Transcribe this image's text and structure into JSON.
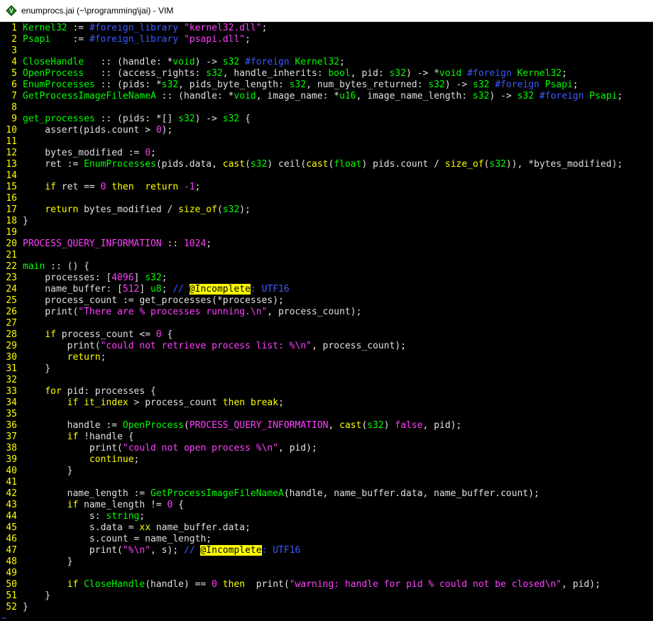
{
  "window": {
    "title": "enumprocs.jai (~\\programming\\jai) - VIM",
    "icon": "vim-icon"
  },
  "editor": {
    "lines": [
      [
        [
          "Kernel32",
          "fn"
        ],
        [
          " := ",
          "plain"
        ],
        [
          "#foreign_library",
          "dir"
        ],
        [
          " ",
          "plain"
        ],
        [
          "\"kernel32.dll\"",
          "str"
        ],
        [
          ";",
          "plain"
        ]
      ],
      [
        [
          "Psapi",
          "fn"
        ],
        [
          "    := ",
          "plain"
        ],
        [
          "#foreign_library",
          "dir"
        ],
        [
          " ",
          "plain"
        ],
        [
          "\"psapi.dll\"",
          "str"
        ],
        [
          ";",
          "plain"
        ]
      ],
      [],
      [
        [
          "CloseHandle",
          "fn"
        ],
        [
          "   :: (handle: *",
          "plain"
        ],
        [
          "void",
          "type"
        ],
        [
          ") -> ",
          "plain"
        ],
        [
          "s32",
          "type"
        ],
        [
          " ",
          "plain"
        ],
        [
          "#foreign",
          "dir"
        ],
        [
          " ",
          "plain"
        ],
        [
          "Kernel32",
          "fn"
        ],
        [
          ";",
          "plain"
        ]
      ],
      [
        [
          "OpenProcess",
          "fn"
        ],
        [
          "   :: (access_rights: ",
          "plain"
        ],
        [
          "s32",
          "type"
        ],
        [
          ", handle_inherits: ",
          "plain"
        ],
        [
          "bool",
          "type"
        ],
        [
          ", pid: ",
          "plain"
        ],
        [
          "s32",
          "type"
        ],
        [
          ") -> *",
          "plain"
        ],
        [
          "void",
          "type"
        ],
        [
          " ",
          "plain"
        ],
        [
          "#foreign",
          "dir"
        ],
        [
          " ",
          "plain"
        ],
        [
          "Kernel32",
          "fn"
        ],
        [
          ";",
          "plain"
        ]
      ],
      [
        [
          "EnumProcesses",
          "fn"
        ],
        [
          " :: (pids: *",
          "plain"
        ],
        [
          "s32",
          "type"
        ],
        [
          ", pids_byte_length: ",
          "plain"
        ],
        [
          "s32",
          "type"
        ],
        [
          ", num_bytes_returned: ",
          "plain"
        ],
        [
          "s32",
          "type"
        ],
        [
          ") -> ",
          "plain"
        ],
        [
          "s32",
          "type"
        ],
        [
          " ",
          "plain"
        ],
        [
          "#foreign",
          "dir"
        ],
        [
          " ",
          "plain"
        ],
        [
          "Psapi",
          "fn"
        ],
        [
          ";",
          "plain"
        ]
      ],
      [
        [
          "GetProcessImageFileNameA",
          "fn"
        ],
        [
          " :: (handle: *",
          "plain"
        ],
        [
          "void",
          "type"
        ],
        [
          ", image_name: *",
          "plain"
        ],
        [
          "u16",
          "type"
        ],
        [
          ", image_name_length: ",
          "plain"
        ],
        [
          "s32",
          "type"
        ],
        [
          ") -> ",
          "plain"
        ],
        [
          "s32",
          "type"
        ],
        [
          " ",
          "plain"
        ],
        [
          "#foreign",
          "dir"
        ],
        [
          " ",
          "plain"
        ],
        [
          "Psapi",
          "fn"
        ],
        [
          ";",
          "plain"
        ]
      ],
      [],
      [
        [
          "get_processes",
          "fn"
        ],
        [
          " :: (pids: *[] ",
          "plain"
        ],
        [
          "s32",
          "type"
        ],
        [
          ") -> ",
          "plain"
        ],
        [
          "s32",
          "type"
        ],
        [
          " {",
          "plain"
        ]
      ],
      [
        [
          "    assert(pids.count > ",
          "plain"
        ],
        [
          "0",
          "num"
        ],
        [
          ");",
          "plain"
        ]
      ],
      [],
      [
        [
          "    bytes_modified := ",
          "plain"
        ],
        [
          "0",
          "num"
        ],
        [
          ";",
          "plain"
        ]
      ],
      [
        [
          "    ret := ",
          "plain"
        ],
        [
          "EnumProcesses",
          "fn"
        ],
        [
          "(pids.data, ",
          "plain"
        ],
        [
          "cast",
          "kw"
        ],
        [
          "(",
          "plain"
        ],
        [
          "s32",
          "type"
        ],
        [
          ") ceil(",
          "plain"
        ],
        [
          "cast",
          "kw"
        ],
        [
          "(",
          "plain"
        ],
        [
          "float",
          "type"
        ],
        [
          ") pids.count / ",
          "plain"
        ],
        [
          "size_of",
          "kw"
        ],
        [
          "(",
          "plain"
        ],
        [
          "s32",
          "type"
        ],
        [
          ")), *bytes_modified);",
          "plain"
        ]
      ],
      [],
      [
        [
          "    ",
          "plain"
        ],
        [
          "if",
          "kw"
        ],
        [
          " ret == ",
          "plain"
        ],
        [
          "0",
          "num"
        ],
        [
          " ",
          "plain"
        ],
        [
          "then",
          "kw"
        ],
        [
          "  ",
          "plain"
        ],
        [
          "return",
          "kw"
        ],
        [
          " ",
          "plain"
        ],
        [
          "-1",
          "num"
        ],
        [
          ";",
          "plain"
        ]
      ],
      [],
      [
        [
          "    ",
          "plain"
        ],
        [
          "return",
          "kw"
        ],
        [
          " bytes_modified / ",
          "plain"
        ],
        [
          "size_of",
          "kw"
        ],
        [
          "(",
          "plain"
        ],
        [
          "s32",
          "type"
        ],
        [
          ");",
          "plain"
        ]
      ],
      [
        [
          "}",
          "plain"
        ]
      ],
      [],
      [
        [
          "PROCESS_QUERY_INFORMATION",
          "str"
        ],
        [
          " :: ",
          "plain"
        ],
        [
          "1024",
          "num"
        ],
        [
          ";",
          "plain"
        ]
      ],
      [],
      [
        [
          "main",
          "fn"
        ],
        [
          " :: () {",
          "plain"
        ]
      ],
      [
        [
          "    processes: [",
          "plain"
        ],
        [
          "4096",
          "num"
        ],
        [
          "] ",
          "plain"
        ],
        [
          "s32",
          "type"
        ],
        [
          ";",
          "plain"
        ]
      ],
      [
        [
          "    name_buffer: [",
          "plain"
        ],
        [
          "512",
          "num"
        ],
        [
          "] ",
          "plain"
        ],
        [
          "u8",
          "type"
        ],
        [
          "; ",
          "plain"
        ],
        [
          "// ",
          "cmt"
        ],
        [
          "@Incomplete",
          "todo"
        ],
        [
          ": UTF16",
          "cmt"
        ]
      ],
      [
        [
          "    process_count := get_processes(*processes);",
          "plain"
        ]
      ],
      [
        [
          "    print(",
          "plain"
        ],
        [
          "\"There are % processes running.\\n\"",
          "str"
        ],
        [
          ", process_count);",
          "plain"
        ]
      ],
      [],
      [
        [
          "    ",
          "plain"
        ],
        [
          "if",
          "kw"
        ],
        [
          " process_count <= ",
          "plain"
        ],
        [
          "0",
          "num"
        ],
        [
          " {",
          "plain"
        ]
      ],
      [
        [
          "        print(",
          "plain"
        ],
        [
          "\"could not retrieve process list: %\\n\"",
          "str"
        ],
        [
          ", process_count);",
          "plain"
        ]
      ],
      [
        [
          "        ",
          "plain"
        ],
        [
          "return",
          "kw"
        ],
        [
          ";",
          "plain"
        ]
      ],
      [
        [
          "    }",
          "plain"
        ]
      ],
      [],
      [
        [
          "    ",
          "plain"
        ],
        [
          "for",
          "kw"
        ],
        [
          " pid: processes {",
          "plain"
        ]
      ],
      [
        [
          "        ",
          "plain"
        ],
        [
          "if",
          "kw"
        ],
        [
          " ",
          "plain"
        ],
        [
          "it_index",
          "kw"
        ],
        [
          " > process_count ",
          "plain"
        ],
        [
          "then",
          "kw"
        ],
        [
          " ",
          "plain"
        ],
        [
          "break",
          "kw"
        ],
        [
          ";",
          "plain"
        ]
      ],
      [],
      [
        [
          "        handle := ",
          "plain"
        ],
        [
          "OpenProcess",
          "fn"
        ],
        [
          "(",
          "plain"
        ],
        [
          "PROCESS_QUERY_INFORMATION",
          "str"
        ],
        [
          ", ",
          "plain"
        ],
        [
          "cast",
          "kw"
        ],
        [
          "(",
          "plain"
        ],
        [
          "s32",
          "type"
        ],
        [
          ") ",
          "plain"
        ],
        [
          "false",
          "num"
        ],
        [
          ", pid);",
          "plain"
        ]
      ],
      [
        [
          "        ",
          "plain"
        ],
        [
          "if",
          "kw"
        ],
        [
          " !handle {",
          "plain"
        ]
      ],
      [
        [
          "            print(",
          "plain"
        ],
        [
          "\"could not open process %\\n\"",
          "str"
        ],
        [
          ", pid);",
          "plain"
        ]
      ],
      [
        [
          "            ",
          "plain"
        ],
        [
          "continue",
          "kw"
        ],
        [
          ";",
          "plain"
        ]
      ],
      [
        [
          "        }",
          "plain"
        ]
      ],
      [],
      [
        [
          "        name_length := ",
          "plain"
        ],
        [
          "GetProcessImageFileNameA",
          "fn"
        ],
        [
          "(handle, name_buffer.data, name_buffer.count);",
          "plain"
        ]
      ],
      [
        [
          "        ",
          "plain"
        ],
        [
          "if",
          "kw"
        ],
        [
          " name_length != ",
          "plain"
        ],
        [
          "0",
          "num"
        ],
        [
          " {",
          "plain"
        ]
      ],
      [
        [
          "            s: ",
          "plain"
        ],
        [
          "string",
          "type"
        ],
        [
          ";",
          "plain"
        ]
      ],
      [
        [
          "            s.data = ",
          "plain"
        ],
        [
          "xx",
          "kw"
        ],
        [
          " name_buffer.data;",
          "plain"
        ]
      ],
      [
        [
          "            s.count = name_length;",
          "plain"
        ]
      ],
      [
        [
          "            print(",
          "plain"
        ],
        [
          "\"%\\n\"",
          "str"
        ],
        [
          ", s); ",
          "plain"
        ],
        [
          "// ",
          "cmt"
        ],
        [
          "@Incomplete",
          "todo"
        ],
        [
          ": UTF16",
          "cmt"
        ]
      ],
      [
        [
          "        }",
          "plain"
        ]
      ],
      [],
      [
        [
          "        ",
          "plain"
        ],
        [
          "if",
          "kw"
        ],
        [
          " ",
          "plain"
        ],
        [
          "CloseHandle",
          "fn"
        ],
        [
          "(handle) == ",
          "plain"
        ],
        [
          "0",
          "num"
        ],
        [
          " ",
          "plain"
        ],
        [
          "then",
          "kw"
        ],
        [
          "  print(",
          "plain"
        ],
        [
          "\"warning: handle for pid % could not be closed\\n\"",
          "str"
        ],
        [
          ", pid);",
          "plain"
        ]
      ],
      [
        [
          "    }",
          "plain"
        ]
      ],
      [
        [
          "}",
          "plain"
        ]
      ]
    ],
    "empty_marker": "~"
  }
}
